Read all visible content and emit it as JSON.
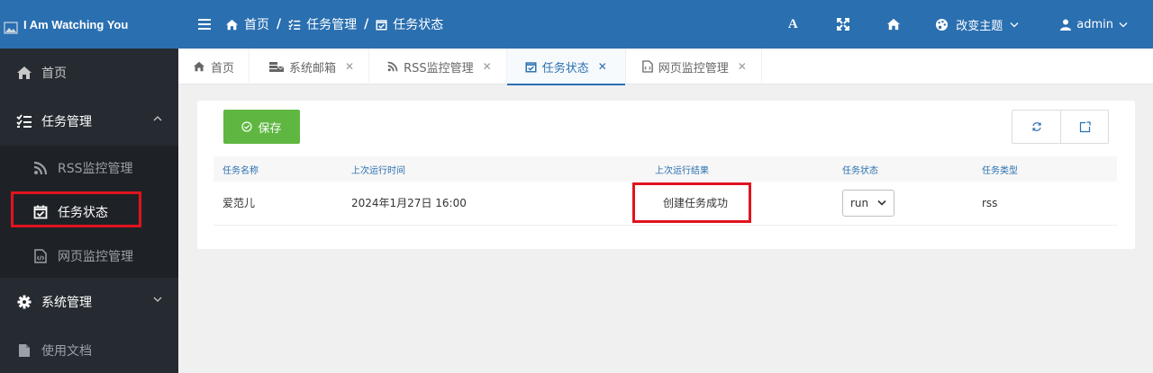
{
  "brand": {
    "title": "I Am Watching You"
  },
  "header": {
    "breadcrumb": [
      "首页",
      "任务管理",
      "任务状态"
    ],
    "font_button": "A",
    "theme_label": "改变主题",
    "user": "admin"
  },
  "sidebar": {
    "items": [
      {
        "label": "首页",
        "icon": "home-icon"
      },
      {
        "label": "任务管理",
        "icon": "tasks-icon"
      },
      {
        "label": "系统管理",
        "icon": "gear-icon"
      },
      {
        "label": "使用文档",
        "icon": "file-icon"
      }
    ],
    "sub_items": [
      {
        "label": "RSS监控管理",
        "icon": "rss-icon"
      },
      {
        "label": "任务状态",
        "icon": "calendar-check-icon"
      },
      {
        "label": "网页监控管理",
        "icon": "code-file-icon"
      }
    ]
  },
  "tabs": [
    {
      "label": "首页",
      "icon": "home-icon",
      "closable": false
    },
    {
      "label": "系统邮箱",
      "icon": "mail-server-icon",
      "closable": true
    },
    {
      "label": "RSS监控管理",
      "icon": "rss-icon",
      "closable": true
    },
    {
      "label": "任务状态",
      "icon": "calendar-check-icon",
      "closable": true,
      "active": true
    },
    {
      "label": "网页监控管理",
      "icon": "code-file-icon",
      "closable": true
    }
  ],
  "toolbar": {
    "save_label": "保存"
  },
  "table": {
    "headers": [
      "任务名称",
      "上次运行时间",
      "上次运行结果",
      "任务状态",
      "任务类型"
    ],
    "rows": [
      {
        "name": "爱范儿",
        "last_run": "2024年1月27日 16:00",
        "result": "创建任务成功",
        "status": "run",
        "type": "rss"
      }
    ]
  },
  "colors": {
    "primary": "#2a6fb0",
    "sidebar": "#262b31",
    "success": "#5fb741",
    "highlight": "#e0141e"
  }
}
